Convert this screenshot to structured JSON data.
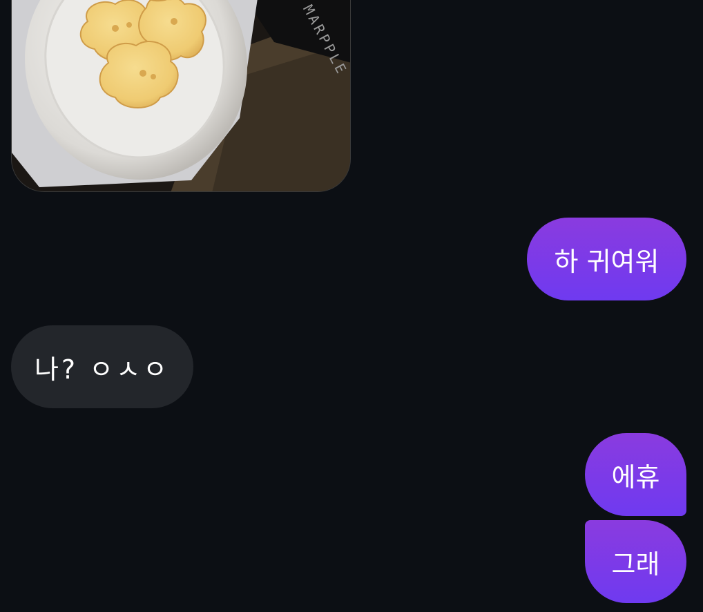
{
  "conversation": {
    "messages": [
      {
        "type": "image",
        "direction": "received",
        "image_desc": "photo-cookies-on-plate",
        "box_text": "MARPPLE"
      },
      {
        "type": "text",
        "direction": "sent",
        "text": "하 귀여워"
      },
      {
        "type": "text",
        "direction": "received",
        "text": "나? ㅇㅅㅇ"
      },
      {
        "type": "text",
        "direction": "sent",
        "text": "에휴"
      },
      {
        "type": "text",
        "direction": "sent",
        "text": "그래"
      }
    ]
  },
  "colors": {
    "background": "#0c0f14",
    "sent_bubble": "#7b3ceb",
    "received_bubble": "#23262b",
    "text": "#ffffff"
  }
}
